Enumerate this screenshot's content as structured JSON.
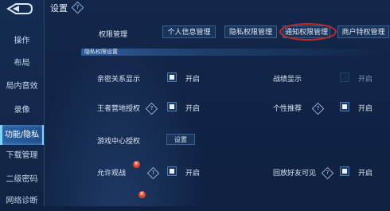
{
  "sidebar": {
    "items": [
      {
        "label": "操作"
      },
      {
        "label": "布局"
      },
      {
        "label": "局内音效"
      },
      {
        "label": "录像"
      },
      {
        "label": "功能/隐私"
      },
      {
        "label": "下载管理"
      },
      {
        "label": "二级密码"
      },
      {
        "label": "网络诊断"
      }
    ],
    "active_index": 4
  },
  "header": {
    "title": "设置"
  },
  "permissions": {
    "label": "权限管理",
    "tabs": [
      {
        "label": "个人信息管理"
      },
      {
        "label": "隐私权限管理"
      },
      {
        "label": "通知权限管理"
      },
      {
        "label": "商户特权管理"
      }
    ],
    "highlighted_tab": 2
  },
  "section": {
    "title": "隐私权限设置"
  },
  "settings": {
    "intimate": {
      "label": "亲密关系显示",
      "state": "开启",
      "checked": true
    },
    "record": {
      "label": "战绩显示",
      "state": "开启",
      "checked": false
    },
    "camp": {
      "label": "王者营地授权",
      "state": "开启",
      "checked": true
    },
    "recommend": {
      "label": "个性推荐",
      "state": "开启",
      "checked": true
    },
    "gamecenter": {
      "label": "游戏中心授权",
      "button": "设置"
    },
    "spectate": {
      "label": "允许观战",
      "state": "开启",
      "checked": true
    },
    "replay": {
      "label": "回放好友可见",
      "state": "开启",
      "checked": true
    }
  },
  "colors": {
    "accent": "#2a63a8",
    "highlight_ring": "#c22a2a",
    "badge": "#d6452c"
  }
}
